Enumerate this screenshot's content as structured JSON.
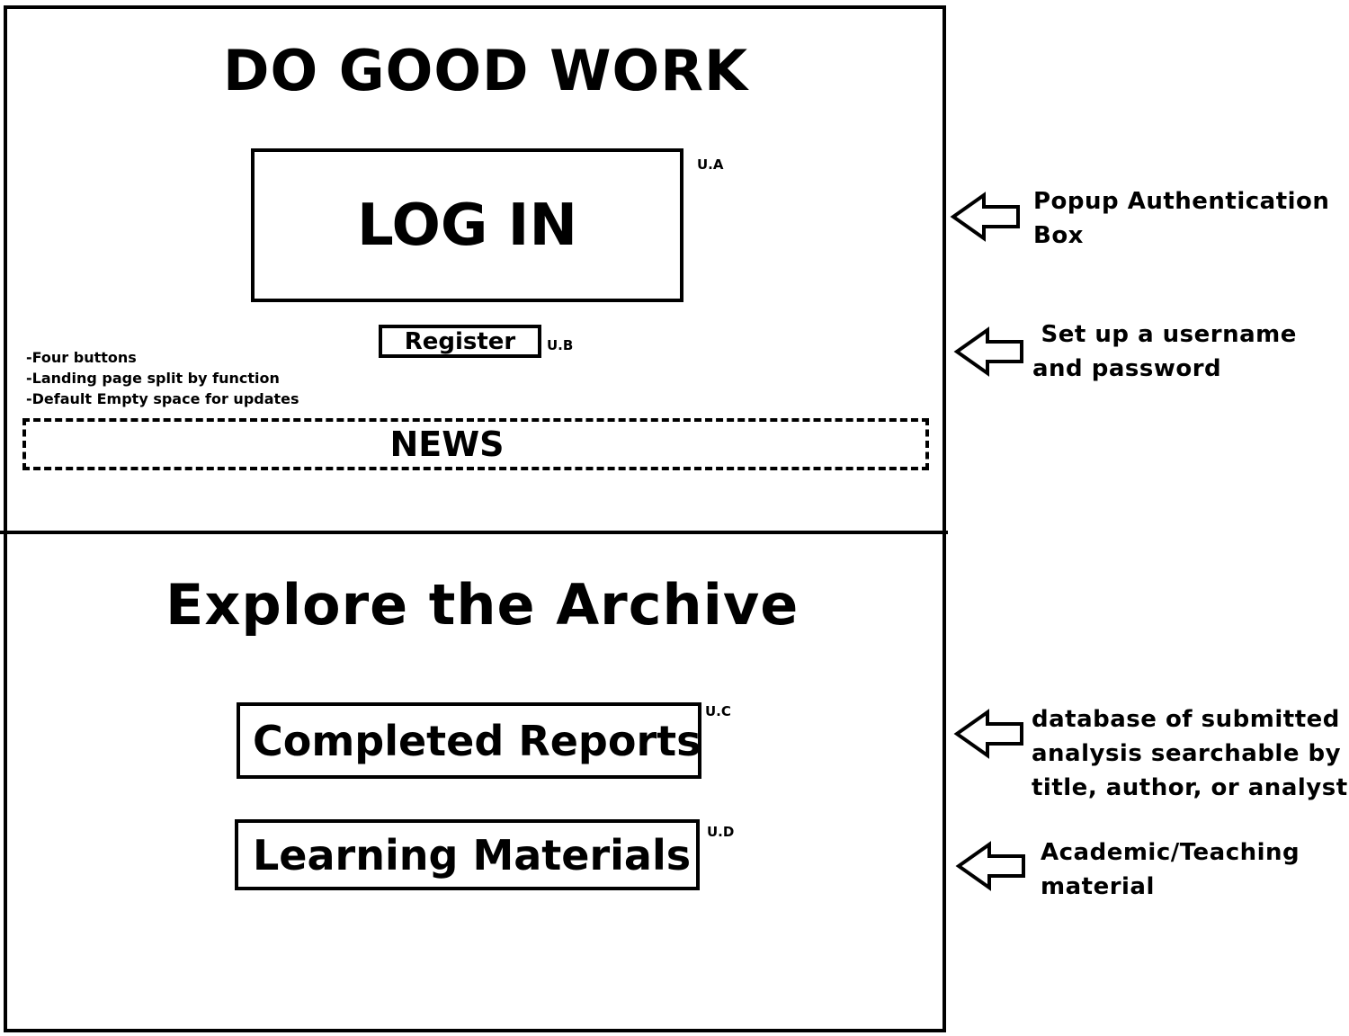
{
  "header": {
    "title": "DO GOOD WORK"
  },
  "auth": {
    "login_label": "LOG IN",
    "login_tag": "U.A",
    "register_label": "Register",
    "register_tag": "U.B"
  },
  "notes": [
    "-Four buttons",
    "-Landing page split by function",
    "-Default Empty space for updates"
  ],
  "news": {
    "label": "NEWS"
  },
  "archive": {
    "title": "Explore the Archive",
    "reports_label": "Completed Reports",
    "reports_tag": "U.C",
    "learning_label": "Learning Materials",
    "learning_tag": "U.D"
  },
  "annotations": {
    "auth": [
      "Popup Authentication",
      "Box"
    ],
    "register": [
      " Set up a username",
      "and password"
    ],
    "reports": [
      "database of submitted",
      "analysis searchable by",
      "title, author, or analyst"
    ],
    "learning": [
      "Academic/Teaching",
      "material"
    ]
  },
  "icons": {
    "annotation_arrow": "left-arrow-outline-icon"
  },
  "colors": {
    "ink": "#000000",
    "background": "#ffffff"
  }
}
